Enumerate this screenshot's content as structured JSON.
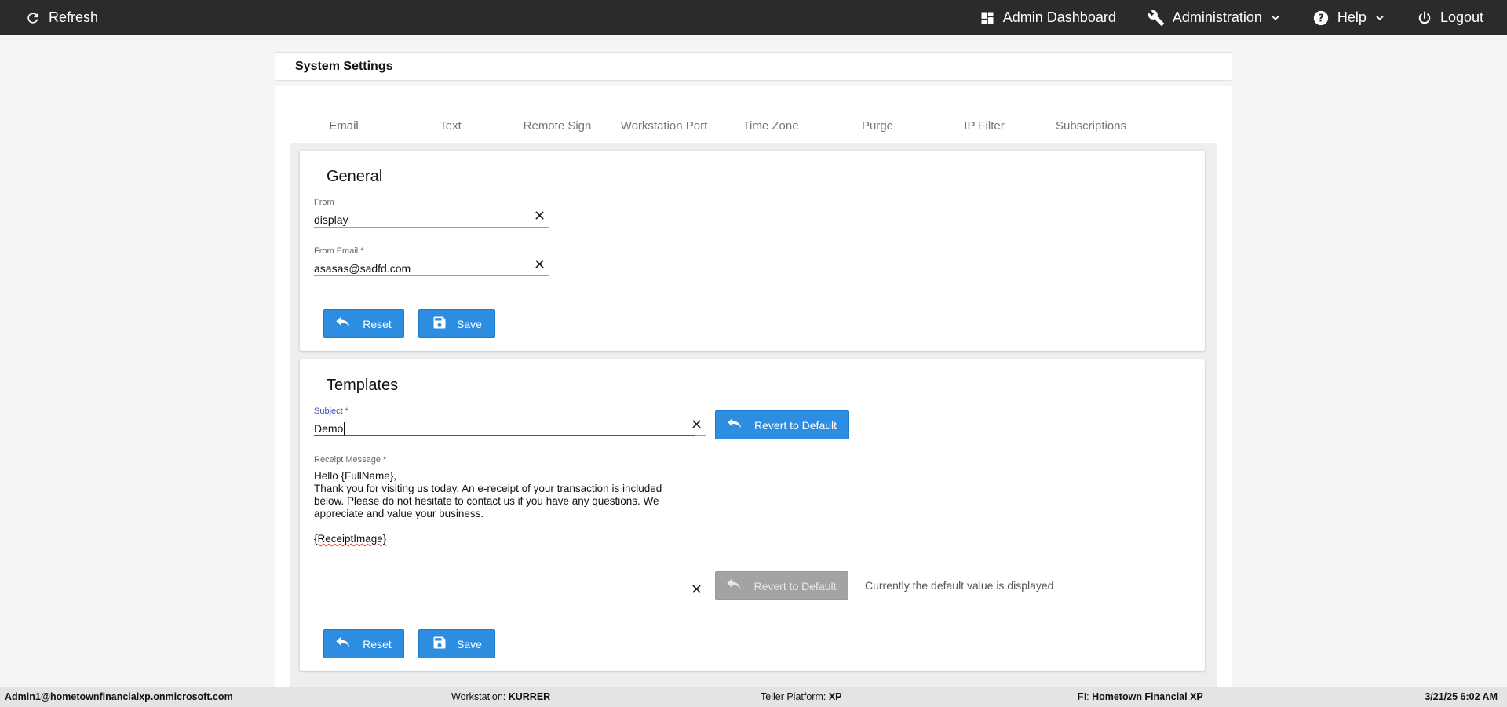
{
  "topbar": {
    "refresh_label": "Refresh",
    "admin_dashboard_label": "Admin Dashboard",
    "administration_label": "Administration",
    "help_label": "Help",
    "logout_label": "Logout"
  },
  "page_title": "System Settings",
  "tabs": [
    {
      "label": "Email",
      "active": true
    },
    {
      "label": "Text"
    },
    {
      "label": "Remote Sign"
    },
    {
      "label": "Workstation Port"
    },
    {
      "label": "Time Zone"
    },
    {
      "label": "Purge"
    },
    {
      "label": "IP Filter"
    },
    {
      "label": "Subscriptions"
    }
  ],
  "general": {
    "title": "General",
    "from_label": "From",
    "from_value": "display",
    "from_email_label": "From Email *",
    "from_email_value": "asasas@sadfd.com",
    "reset_label": "Reset",
    "save_label": "Save"
  },
  "templates": {
    "title": "Templates",
    "subject_label": "Subject *",
    "subject_value": "Demo",
    "revert_label": "Revert to Default",
    "receipt_label": "Receipt Message *",
    "receipt_line1": "Hello {FullName},\nThank you for visiting us today. An e-receipt of your transaction is included below. Please do not hesitate to contact us if you have any questions. We appreciate and value your business.",
    "receipt_line2": "{ReceiptImage}",
    "revert2_label": "Revert to Default",
    "default_note": "Currently the default value is displayed",
    "reset_label": "Reset",
    "save_label": "Save"
  },
  "statusbar": {
    "user": "Admin1@hometownfinancialxp.onmicrosoft.com",
    "workstation_label": "Workstation: ",
    "workstation_value": "KURRER",
    "teller_label": "Teller Platform: ",
    "teller_value": "XP",
    "fi_label": "FI: ",
    "fi_value": "Hometown Financial XP",
    "datetime": "3/21/25 6:02 AM"
  },
  "colors": {
    "topbar": "#2b2b2b",
    "button": "#2d8ee1",
    "button_disabled": "#a3a3a3",
    "accent": "#3f51b5"
  }
}
